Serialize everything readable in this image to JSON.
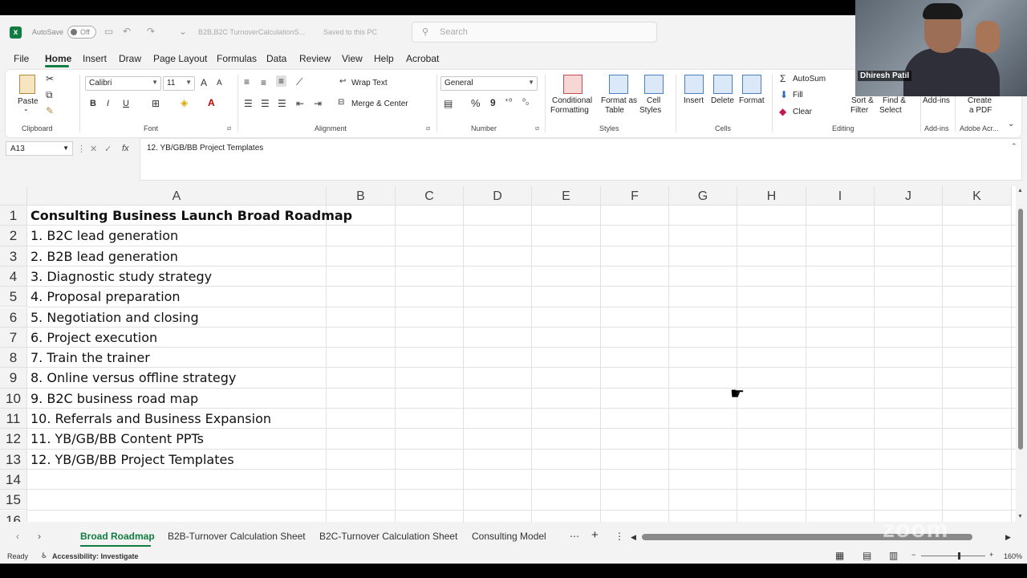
{
  "title_bar": {
    "autosave_label": "AutoSave",
    "autosave_state": "Off",
    "document_title": "B2B,B2C TurnoverCalculationS...",
    "save_status": "Saved to this PC",
    "search_placeholder": "Search"
  },
  "menu": [
    "File",
    "Home",
    "Insert",
    "Draw",
    "Page Layout",
    "Formulas",
    "Data",
    "Review",
    "View",
    "Help",
    "Acrobat"
  ],
  "ribbon": {
    "clipboard": {
      "paste": "Paste",
      "label": "Clipboard"
    },
    "font": {
      "family": "Calibri",
      "size": "11",
      "bold": "B",
      "italic": "I",
      "underline": "U",
      "label": "Font",
      "grow": "A",
      "shrink": "A"
    },
    "alignment": {
      "wrap": "Wrap Text",
      "merge": "Merge & Center",
      "label": "Alignment"
    },
    "number": {
      "format": "General",
      "percent": "%",
      "comma": "9",
      "label": "Number"
    },
    "styles": {
      "conditional_1": "Conditional",
      "conditional_2": "Formatting",
      "format_table_1": "Format as",
      "format_table_2": "Table",
      "cell_styles_1": "Cell",
      "cell_styles_2": "Styles",
      "label": "Styles"
    },
    "cells": {
      "insert": "Insert",
      "delete": "Delete",
      "format": "Format",
      "label": "Cells"
    },
    "editing": {
      "autosum": "AutoSum",
      "fill": "Fill",
      "clear": "Clear",
      "sort_1": "Sort &",
      "sort_2": "Filter",
      "find_1": "Find &",
      "find_2": "Select",
      "label": "Editing"
    },
    "addins": {
      "button": "Add-ins",
      "label": "Add-ins"
    },
    "acrobat": {
      "create_1": "Create",
      "create_2": "a PDF",
      "label": "Adobe Acr..."
    }
  },
  "formula_bar": {
    "cell_ref": "A13",
    "fx": "fx",
    "content": "12. YB/GB/BB Project Templates"
  },
  "grid": {
    "columns": [
      "A",
      "B",
      "C",
      "D",
      "E",
      "F",
      "G",
      "H",
      "I",
      "J",
      "K"
    ],
    "rows": [
      "1",
      "2",
      "3",
      "4",
      "5",
      "6",
      "7",
      "8",
      "9",
      "10",
      "11",
      "12",
      "13",
      "14",
      "15",
      "16"
    ],
    "cells_a": [
      "Consulting Business Launch Broad Roadmap",
      "1. B2C lead generation",
      "2. B2B lead generation",
      "3. Diagnostic study strategy",
      "4. Proposal preparation",
      "5. Negotiation and closing",
      "6. Project execution",
      "7. Train the trainer",
      "8. Online versus offline strategy",
      "9. B2C business road map",
      "10. Referrals and Business Expansion",
      "11. YB/GB/BB Content PPTs",
      "12. YB/GB/BB Project Templates"
    ]
  },
  "sheet_tabs": [
    "Broad Roadmap",
    "B2B-Turnover Calculation Sheet",
    "B2C-Turnover Calculation Sheet",
    "Consulting Model"
  ],
  "status_bar": {
    "ready": "Ready",
    "accessibility": "Accessibility: Investigate",
    "zoom": "160%"
  },
  "webcam": {
    "participant_name": "Dhiresh Patil"
  },
  "watermark": "zoom",
  "colors": {
    "accent": "#107c41",
    "ribbon_bg": "#ffffff",
    "chrome_bg": "#f3f3f3"
  }
}
